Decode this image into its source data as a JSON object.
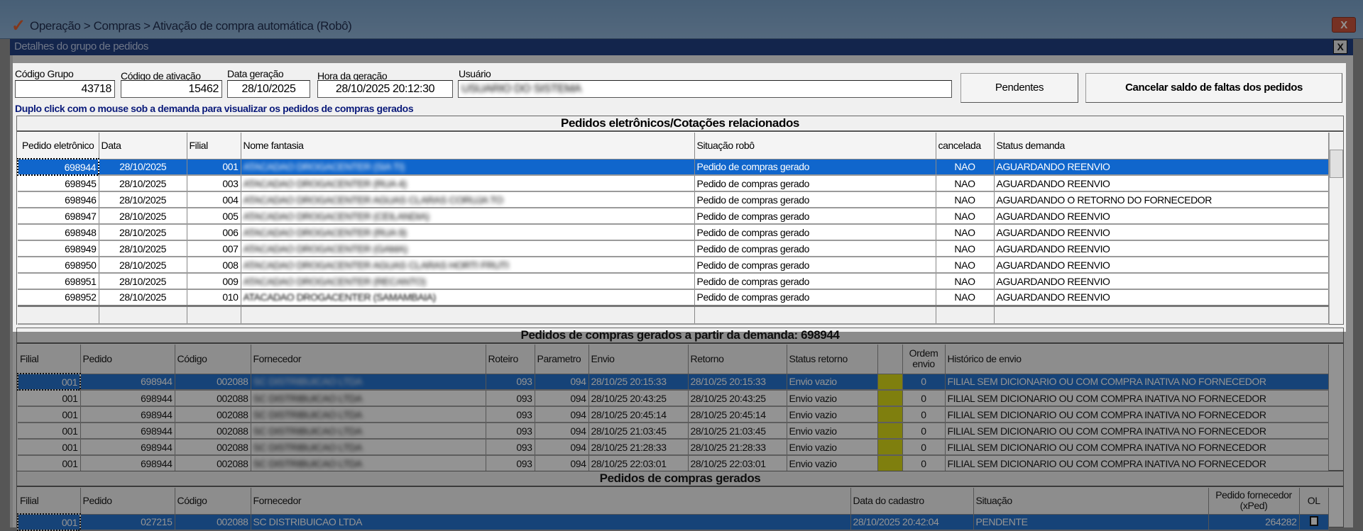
{
  "window": {
    "title": "Operação > Compras > Ativação de compra automática (Robô)",
    "close": "X"
  },
  "dialog": {
    "title": "Detalhes do grupo de pedidos",
    "close": "X"
  },
  "fields": {
    "codigo_grupo": {
      "label": "Código Grupo",
      "value": "43718"
    },
    "codigo_ativacao": {
      "label": "Código de ativação",
      "value": "15462"
    },
    "data_geracao": {
      "label": "Data geração",
      "value": "28/10/2025"
    },
    "hora_geracao": {
      "label": "Hora da geração",
      "value": "28/10/2025 20:12:30"
    },
    "usuario": {
      "label": "Usuário",
      "value": "USUARIO DO SISTEMA"
    }
  },
  "buttons": {
    "pendentes": "Pendentes",
    "cancelar": "Cancelar saldo de faltas dos pedidos"
  },
  "hint": "Duplo click com o mouse sob a demanda para visualizar os pedidos de compras gerados",
  "grid1": {
    "title": "Pedidos eletrônicos/Cotações relacionados",
    "headers": [
      "Pedido eletrônico",
      "Data",
      "Filial",
      "Nome fantasia",
      "Situação robô",
      "cancelada",
      "Status demanda"
    ],
    "rows": [
      [
        "698944",
        "28/10/2025",
        "001",
        "ATACADAO DROGACENTER (SIA TI)",
        "Pedido de compras gerado",
        "NAO",
        "AGUARDANDO REENVIO"
      ],
      [
        "698945",
        "28/10/2025",
        "003",
        "ATACADAO DROGACENTER (RUA 4)",
        "Pedido de compras gerado",
        "NAO",
        "AGUARDANDO REENVIO"
      ],
      [
        "698946",
        "28/10/2025",
        "004",
        "ATACADAO DROGACENTER AGUAS CLARAS CORUJA TO",
        "Pedido de compras gerado",
        "NAO",
        "AGUARDANDO O RETORNO DO FORNECEDOR"
      ],
      [
        "698947",
        "28/10/2025",
        "005",
        "ATACADAO DROGACENTER (CEILANDIA)",
        "Pedido de compras gerado",
        "NAO",
        "AGUARDANDO REENVIO"
      ],
      [
        "698948",
        "28/10/2025",
        "006",
        "ATACADAO DROGACENTER (RUA 9)",
        "Pedido de compras gerado",
        "NAO",
        "AGUARDANDO REENVIO"
      ],
      [
        "698949",
        "28/10/2025",
        "007",
        "ATACADAO DROGACENTER (GAMA)",
        "Pedido de compras gerado",
        "NAO",
        "AGUARDANDO REENVIO"
      ],
      [
        "698950",
        "28/10/2025",
        "008",
        "ATACADAO DROGACENTER AGUAS CLARAS HORTI FRUTI",
        "Pedido de compras gerado",
        "NAO",
        "AGUARDANDO REENVIO"
      ],
      [
        "698951",
        "28/10/2025",
        "009",
        "ATACADAO DROGACENTER (RECANTO)",
        "Pedido de compras gerado",
        "NAO",
        "AGUARDANDO REENVIO"
      ],
      [
        "698952",
        "28/10/2025",
        "010",
        "ATACADAO DROGACENTER (SAMAMBAIA)",
        "Pedido de compras gerado",
        "NAO",
        "AGUARDANDO REENVIO"
      ]
    ]
  },
  "grid2": {
    "title": "Pedidos de compras gerados a partir da demanda: 698944",
    "headers": [
      "Filial",
      "Pedido",
      "Código",
      "Fornecedor",
      "Roteiro",
      "Parametro",
      "Envio",
      "Retorno",
      "Status retorno",
      "",
      "Ordem envio",
      "Histórico de envio"
    ],
    "rows": [
      [
        "001",
        "698944",
        "002088",
        "SC DISTRIBUICAO LTDA",
        "093",
        "094",
        "28/10/25 20:15:33",
        "28/10/25 20:15:33",
        "Envio vazio",
        "",
        "0",
        "FILIAL SEM DICIONARIO OU COM COMPRA INATIVA NO FORNECEDOR"
      ],
      [
        "001",
        "698944",
        "002088",
        "SC DISTRIBUICAO LTDA",
        "093",
        "094",
        "28/10/25 20:43:25",
        "28/10/25 20:43:25",
        "Envio vazio",
        "",
        "0",
        "FILIAL SEM DICIONARIO OU COM COMPRA INATIVA NO FORNECEDOR"
      ],
      [
        "001",
        "698944",
        "002088",
        "SC DISTRIBUICAO LTDA",
        "093",
        "094",
        "28/10/25 20:45:14",
        "28/10/25 20:45:14",
        "Envio vazio",
        "",
        "0",
        "FILIAL SEM DICIONARIO OU COM COMPRA INATIVA NO FORNECEDOR"
      ],
      [
        "001",
        "698944",
        "002088",
        "SC DISTRIBUICAO LTDA",
        "093",
        "094",
        "28/10/25 21:03:45",
        "28/10/25 21:03:45",
        "Envio vazio",
        "",
        "0",
        "FILIAL SEM DICIONARIO OU COM COMPRA INATIVA NO FORNECEDOR"
      ],
      [
        "001",
        "698944",
        "002088",
        "SC DISTRIBUICAO LTDA",
        "093",
        "094",
        "28/10/25 21:28:33",
        "28/10/25 21:28:33",
        "Envio vazio",
        "",
        "0",
        "FILIAL SEM DICIONARIO OU COM COMPRA INATIVA NO FORNECEDOR"
      ],
      [
        "001",
        "698944",
        "002088",
        "SC DISTRIBUICAO LTDA",
        "093",
        "094",
        "28/10/25 22:03:01",
        "28/10/25 22:03:01",
        "Envio vazio",
        "",
        "0",
        "FILIAL SEM DICIONARIO OU COM COMPRA INATIVA NO FORNECEDOR"
      ]
    ],
    "status_color": "#d8d800"
  },
  "grid3": {
    "title": "Pedidos de compras gerados",
    "headers": [
      "Filial",
      "Pedido",
      "Código",
      "Fornecedor",
      "Data do cadastro",
      "Situação",
      "Pedido fornecedor (xPed)",
      "OL"
    ],
    "rows": [
      [
        "001",
        "027215",
        "002088",
        "SC DISTRIBUICAO LTDA",
        "28/10/2025 20:42:04",
        "PENDENTE",
        "264282",
        ""
      ]
    ]
  },
  "colors": {
    "selection": "#1066cc",
    "dialog_bar": "#0b2c78"
  }
}
